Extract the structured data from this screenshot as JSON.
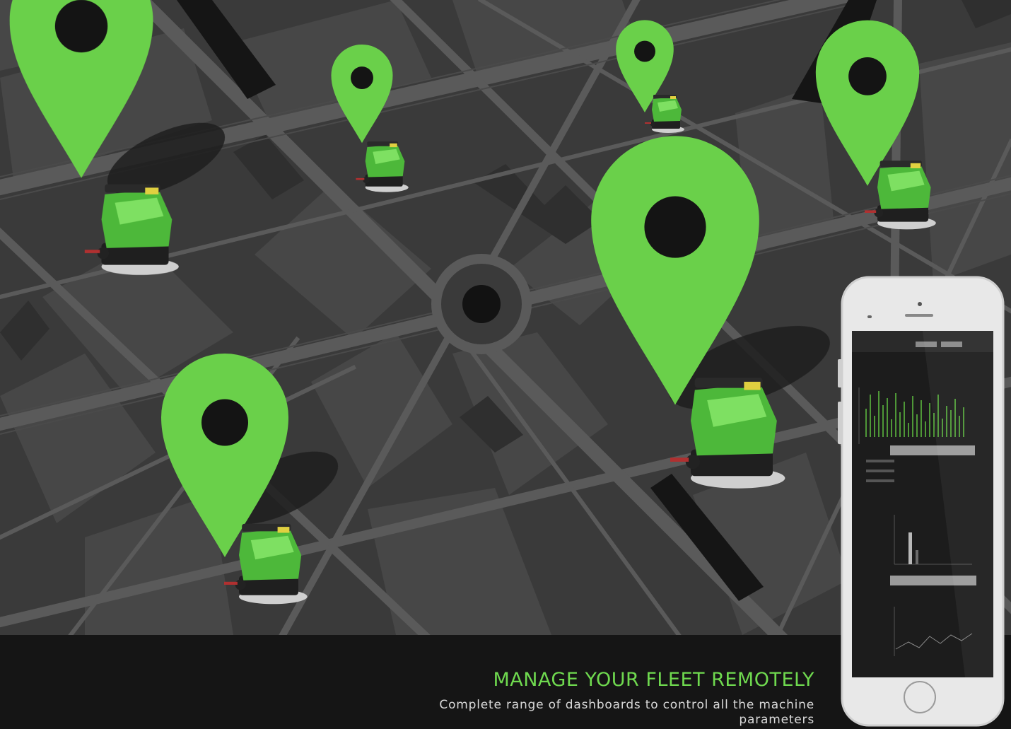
{
  "promo": {
    "headline": "MANAGE YOUR FLEET REMOTELY",
    "subline": "Complete range of dashboards to control all the machine parameters"
  },
  "colors": {
    "map_background": "#3b3b3b",
    "map_block": "#484848",
    "road": "#5c5c5c",
    "pin": "#6ad04a",
    "pin_hole": "#141414",
    "footer_band": "#151515",
    "headline": "#6fd94f",
    "subline": "#d9d9d9"
  },
  "map": {
    "pins": [
      {
        "name": "pin-1",
        "machine": "floor-scrubber"
      },
      {
        "name": "pin-2",
        "machine": "floor-scrubber"
      },
      {
        "name": "pin-3",
        "machine": "floor-scrubber"
      },
      {
        "name": "pin-4",
        "machine": "floor-scrubber"
      },
      {
        "name": "pin-5",
        "machine": "floor-scrubber"
      },
      {
        "name": "pin-6",
        "machine": "floor-scrubber"
      }
    ]
  },
  "phone": {
    "icon": "smartphone-dashboard-icon",
    "screen_content": "fleet dashboard with charts"
  }
}
